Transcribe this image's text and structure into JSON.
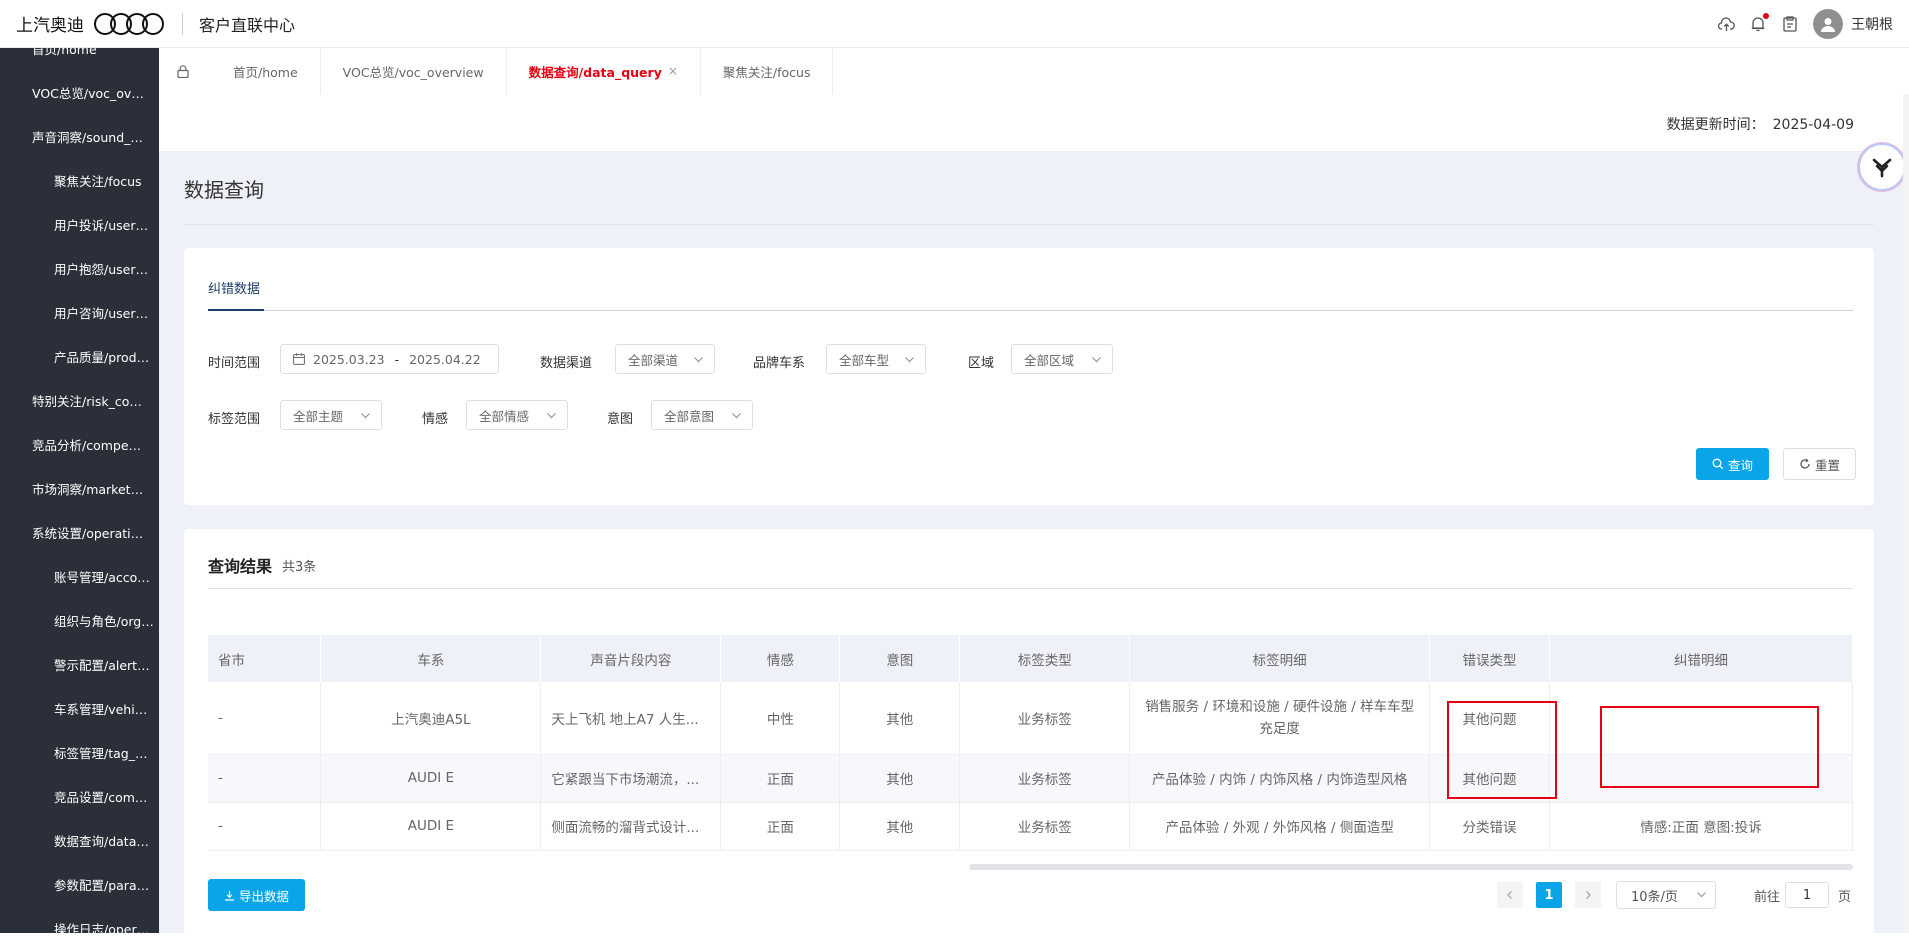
{
  "header": {
    "brand": "上汽奥迪",
    "app_title": "客户直联中心",
    "user_name": "王朝根",
    "icons": [
      "cloud-upload-icon",
      "bell-icon",
      "clipboard-icon",
      "user-avatar-icon"
    ]
  },
  "sidebar": {
    "items": [
      {
        "label": "首页/home",
        "level": 1
      },
      {
        "label": "VOC总览/voc_overview",
        "level": 1
      },
      {
        "label": "声音洞察/sound_insight",
        "level": 1
      },
      {
        "label": "聚焦关注/focus",
        "level": 2
      },
      {
        "label": "用户投诉/user_complaint",
        "level": 2
      },
      {
        "label": "用户抱怨/user_grumble",
        "level": 2
      },
      {
        "label": "用户咨询/user_consult",
        "level": 2
      },
      {
        "label": "产品质量/product_quality",
        "level": 2
      },
      {
        "label": "特别关注/risk_control",
        "level": 1
      },
      {
        "label": "竞品分析/competition",
        "level": 1
      },
      {
        "label": "市场洞察/market_insight",
        "level": 1
      },
      {
        "label": "系统设置/operation_setting",
        "level": 1
      },
      {
        "label": "账号管理/account",
        "level": 2
      },
      {
        "label": "组织与角色/organization",
        "level": 2
      },
      {
        "label": "警示配置/alert_config",
        "level": 2
      },
      {
        "label": "车系管理/vehicle_series",
        "level": 2
      },
      {
        "label": "标签管理/tag_manage",
        "level": 2
      },
      {
        "label": "竞品设置/competitor",
        "level": 2
      },
      {
        "label": "数据查询/data_query",
        "level": 2
      },
      {
        "label": "参数配置/param_config",
        "level": 2
      },
      {
        "label": "操作日志/operation_log",
        "level": 2
      }
    ]
  },
  "tabs": [
    {
      "label": "首页/home",
      "active": false
    },
    {
      "label": "VOC总览/voc_overview",
      "active": false
    },
    {
      "label": "数据查询/data_query",
      "active": true,
      "closable": "×"
    },
    {
      "label": "聚焦关注/focus",
      "active": false
    }
  ],
  "update": {
    "label": "数据更新时间：",
    "value": "2025-04-09"
  },
  "page": {
    "title": "数据查询"
  },
  "filters": {
    "subtab": "纠错数据",
    "time_label": "时间范围",
    "date_start": "2025.03.23",
    "date_sep": "-",
    "date_end": "2025.04.22",
    "channel_label": "数据渠道",
    "channel_value": "全部渠道",
    "brand_label": "品牌车系",
    "brand_value": "全部车型",
    "region_label": "区域",
    "region_value": "全部区域",
    "tag_label": "标签范围",
    "tag_value": "全部主题",
    "emotion_label": "情感",
    "emotion_value": "全部情感",
    "intent_label": "意图",
    "intent_value": "全部意图",
    "query_btn": "查询",
    "reset_btn": "重置"
  },
  "results": {
    "title": "查询结果",
    "count": "共3条",
    "columns": [
      "省市",
      "车系",
      "声音片段内容",
      "情感",
      "意图",
      "标签类型",
      "标签明细",
      "错误类型",
      "纠错明细"
    ],
    "rows": [
      {
        "province": "-",
        "series": "上汽奥迪A5L",
        "content": "天上飞机 地上A7 人生...",
        "emotion": "中性",
        "intent": "其他",
        "tag_type": "业务标签",
        "tag_detail": "销售服务 / 环境和设施 / 硬件设施 / 样车车型充足度",
        "error_type": "其他问题",
        "correction": ""
      },
      {
        "province": "-",
        "series": "AUDI E",
        "content": "它紧跟当下市场潮流，...",
        "emotion": "正面",
        "intent": "其他",
        "tag_type": "业务标签",
        "tag_detail": "产品体验 / 内饰 / 内饰风格 / 内饰造型风格",
        "error_type": "其他问题",
        "correction": ""
      },
      {
        "province": "-",
        "series": "AUDI E",
        "content": "侧面流畅的溜背式设计...",
        "emotion": "正面",
        "intent": "其他",
        "tag_type": "业务标签",
        "tag_detail": "产品体验 / 外观 / 外饰风格 / 侧面造型",
        "error_type": "分类错误",
        "correction": "情感:正面 意图:投诉"
      }
    ],
    "export_btn": "导出数据"
  },
  "pagination": {
    "current": "1",
    "page_size": "10条/页",
    "goto_label": "前往",
    "goto_value": "1",
    "page_unit": "页"
  },
  "colors": {
    "accent": "#0aa5e8",
    "active_tab": "#e60012",
    "sidebar_bg": "#2b2f3a",
    "content_bg": "#eef1f7"
  }
}
